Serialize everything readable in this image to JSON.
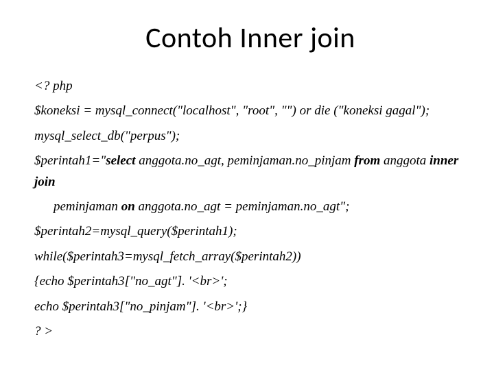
{
  "title": "Contoh Inner join",
  "lines": {
    "l1": "<? php",
    "l2": "$koneksi = mysql_connect(\"localhost\", \"root\", \"\") or die (\"koneksi gagal\");",
    "l3": "mysql_select_db(\"perpus\");",
    "l4a": "$perintah1=\"",
    "l4b": "select",
    "l4c": " anggota.no_agt, peminjaman.no_pinjam ",
    "l4d": "from",
    "l4e": " anggota ",
    "l4f": "inner join",
    "l5a": "peminjaman ",
    "l5b": "on",
    "l5c": " anggota.no_agt = peminjaman.no_agt\";",
    "l6": "$perintah2=mysql_query($perintah1);",
    "l7": "while($perintah3=mysql_fetch_array($perintah2))",
    "l8": "{echo $perintah3[\"no_agt\"]. '<br>';",
    "l9": " echo $perintah3[\"no_pinjam\"]. '<br>';}",
    "l10": "? >"
  }
}
